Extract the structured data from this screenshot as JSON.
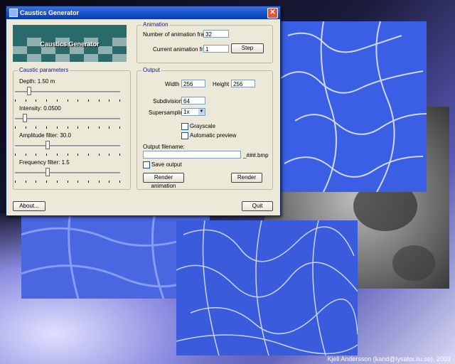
{
  "window": {
    "title": "Caustics Generator",
    "preview_label": "Caustics Generator"
  },
  "animation": {
    "group_title": "Animation",
    "frames_label": "Number of animation frames",
    "frames_value": "32",
    "current_label": "Current animation frame",
    "current_value": "1",
    "step_label": "Step"
  },
  "caustic": {
    "group_title": "Caustic parameters",
    "depth_label": "Depth: 1.50 m",
    "depth_level": 0.12,
    "intensity_label": "Intensity: 0.0500",
    "intensity_level": 0.08,
    "amplitude_label": "Amplitude filter: 30.0",
    "amplitude_level": 0.3,
    "frequency_label": "Frequency filter: 1.5",
    "frequency_level": 0.3
  },
  "output": {
    "group_title": "Output",
    "width_label": "Width",
    "width_value": "256",
    "height_label": "Height",
    "height_value": "256",
    "subdivisions_label": "Subdivisions",
    "subdivisions_value": "64",
    "supersampling_label": "Supersampling",
    "supersampling_value": "1x",
    "grayscale_label": "Grayscale",
    "auto_preview_label": "Automatic preview",
    "filename_label": "Output filename:",
    "filename_value": "",
    "filename_suffix": "_###.bmp",
    "save_label": "Save output",
    "render_anim_label": "Render animation",
    "render_label": "Render"
  },
  "footer": {
    "about_label": "About...",
    "quit_label": "Quit"
  },
  "credit": "Kjell Andersson (kand@lysator.liu.se), 2003",
  "colors": {
    "caustic_blue": "#4a68e0",
    "titlebar": "#1450c8",
    "dialog": "#ece9d8"
  }
}
